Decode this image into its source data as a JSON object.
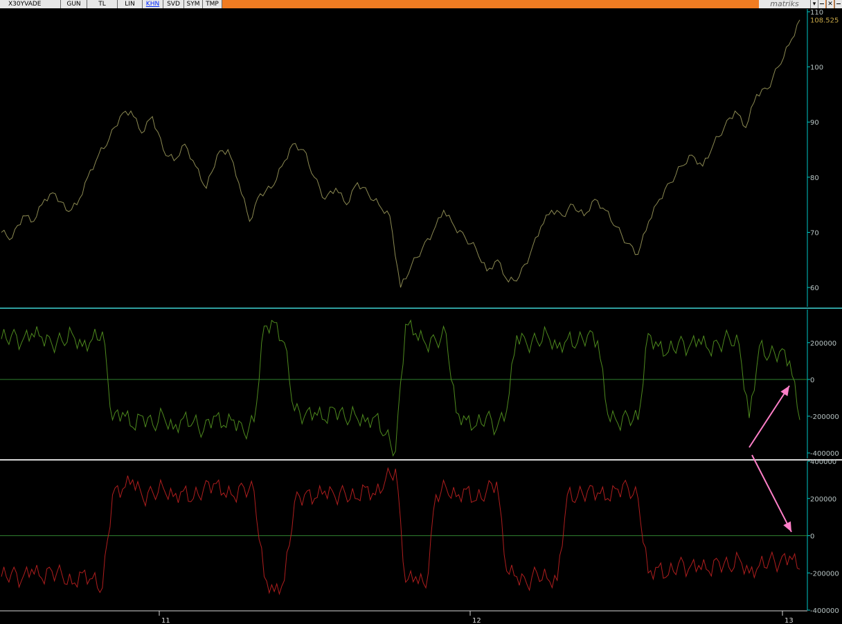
{
  "toolbar": {
    "symbol": "X30YVADE",
    "buttons": [
      "GUN",
      "TL",
      "LIN",
      "KHN",
      "SVD",
      "SYM",
      "TMP"
    ],
    "active_button": "KHN",
    "brand": "matriks",
    "dropdown_icon": "chevron-down-icon",
    "minimize_icon": "minimize-icon",
    "close_icon": "close-icon"
  },
  "colors": {
    "price": "#8c8a52",
    "osc1": "#4e8a1e",
    "osc2": "#b01e1e",
    "axis": "#00c8c8",
    "last_price": "#c8a848",
    "zeroline": "#2f7f2f",
    "arrow": "#ff7fc8"
  },
  "chart_data": [
    {
      "type": "line",
      "panel": "price",
      "ylim": [
        56.5,
        110.5
      ],
      "yticks": [
        60,
        70,
        80,
        90,
        100,
        110
      ],
      "last_value_label": "108.525",
      "x_tick_labels": [
        "11",
        "12",
        "13"
      ],
      "series": [
        {
          "values": [
            70,
            69,
            73,
            72,
            76,
            77,
            74,
            75,
            80,
            84,
            87,
            91,
            92,
            88,
            91,
            85,
            83,
            86,
            82,
            78,
            84,
            85,
            79,
            72,
            77,
            78,
            82,
            86,
            85,
            80,
            76,
            78,
            75,
            79,
            77,
            75,
            73,
            60,
            64,
            67,
            70,
            74,
            71,
            69,
            67,
            63,
            65,
            61,
            62,
            66,
            71,
            74,
            73,
            75,
            73,
            76,
            74,
            71,
            68,
            66,
            72,
            76,
            79,
            82,
            84,
            82,
            86,
            89,
            92,
            89,
            95,
            96,
            100,
            104,
            108.525
          ]
        }
      ]
    },
    {
      "type": "line",
      "panel": "oscillator-1",
      "ylim": [
        -430000,
        380000
      ],
      "yticks": [
        -400000,
        -200000,
        0,
        200000
      ],
      "series": [
        {
          "values": [
            220000,
            240000,
            200000,
            250000,
            230000,
            190000,
            210000,
            250000,
            180000,
            220000,
            260000,
            -220000,
            -180000,
            -260000,
            -200000,
            -250000,
            -190000,
            -270000,
            -210000,
            -230000,
            -280000,
            -200000,
            -250000,
            -220000,
            -290000,
            -230000,
            290000,
            310000,
            200000,
            -170000,
            -200000,
            -180000,
            -220000,
            -160000,
            -210000,
            -190000,
            -230000,
            -200000,
            -300000,
            -390000,
            300000,
            250000,
            190000,
            210000,
            250000,
            -180000,
            -220000,
            -250000,
            -200000,
            -270000,
            -170000,
            240000,
            190000,
            210000,
            250000,
            170000,
            220000,
            200000,
            240000,
            210000,
            -190000,
            -240000,
            -200000,
            -220000,
            250000,
            180000,
            150000,
            200000,
            170000,
            220000,
            160000,
            190000,
            230000,
            190000,
            -210000,
            180000,
            130000,
            150000,
            100000,
            -220000
          ]
        }
      ]
    },
    {
      "type": "line",
      "panel": "oscillator-2",
      "ylim": [
        -400000,
        400000
      ],
      "yticks": [
        -400000,
        -200000,
        0,
        200000,
        400000
      ],
      "series": [
        {
          "values": [
            -220000,
            -200000,
            -240000,
            -180000,
            -230000,
            -190000,
            -210000,
            -260000,
            -200000,
            -230000,
            -280000,
            220000,
            250000,
            300000,
            200000,
            230000,
            260000,
            210000,
            240000,
            200000,
            250000,
            280000,
            230000,
            210000,
            260000,
            240000,
            -220000,
            -300000,
            -240000,
            180000,
            220000,
            200000,
            240000,
            210000,
            230000,
            200000,
            260000,
            220000,
            300000,
            360000,
            -250000,
            -220000,
            -280000,
            220000,
            260000,
            210000,
            250000,
            190000,
            240000,
            290000,
            -190000,
            -220000,
            -260000,
            -200000,
            -230000,
            -240000,
            220000,
            210000,
            240000,
            230000,
            200000,
            250000,
            260000,
            200000,
            -200000,
            -170000,
            -210000,
            -150000,
            -180000,
            -160000,
            -190000,
            -140000,
            -170000,
            -120000,
            -200000,
            -160000,
            -130000,
            -150000,
            -110000,
            -180000
          ]
        }
      ]
    }
  ]
}
